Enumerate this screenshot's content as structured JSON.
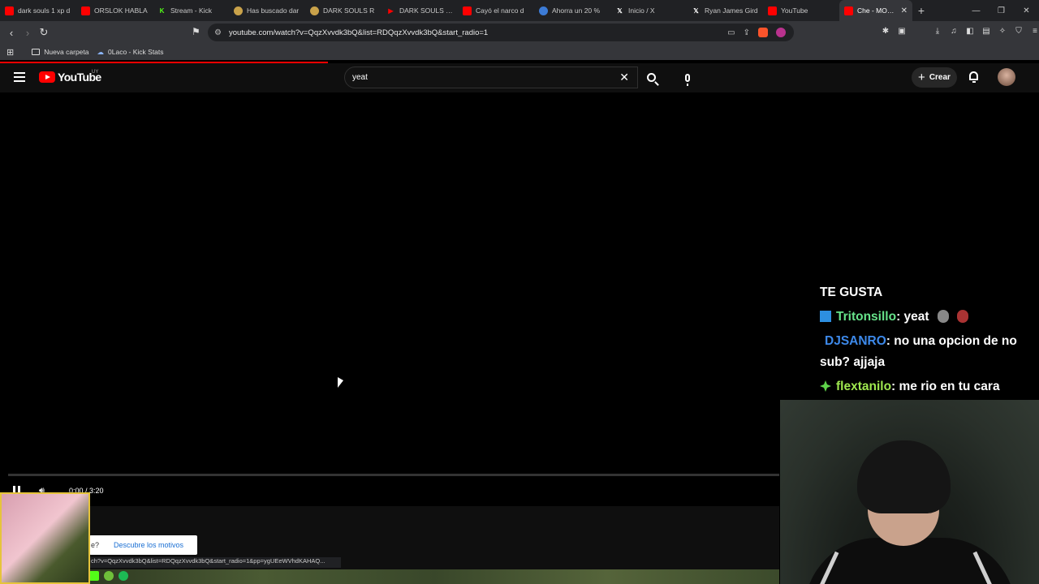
{
  "browser": {
    "tabs": [
      {
        "label": "dark souls 1 xp d",
        "icon": "youtube-icon",
        "color": "#ff0000"
      },
      {
        "label": "ORSLOK HABLA",
        "icon": "youtube-icon",
        "color": "#ff0000"
      },
      {
        "label": "Stream - Kick",
        "icon": "kick-icon",
        "color": "#53fc18"
      },
      {
        "label": "Has buscado dar",
        "icon": "game-icon",
        "color": "#c9a24a"
      },
      {
        "label": "DARK SOULS R",
        "icon": "game-icon",
        "color": "#c9a24a"
      },
      {
        "label": "DARK SOULS RE",
        "icon": "play-icon",
        "color": "#ff0000"
      },
      {
        "label": "Cayó el narco d",
        "icon": "youtube-icon",
        "color": "#ff0000"
      },
      {
        "label": "Ahorra un 20 %",
        "icon": "steam-icon",
        "color": "#3c7bd6"
      },
      {
        "label": "Inicio / X",
        "icon": "x-icon",
        "color": "#ffffff"
      },
      {
        "label": "Ryan James Gird",
        "icon": "x-icon",
        "color": "#ffffff"
      },
      {
        "label": "YouTube",
        "icon": "youtube-icon",
        "color": "#ff0000"
      },
      {
        "label": "Che - MONS",
        "icon": "youtube-icon",
        "color": "#ff0000",
        "active": true
      }
    ],
    "url": "youtube.com/watch?v=QqzXvvdk3bQ&list=RDQqzXvvdk3bQ&start_radio=1",
    "bookmarks": [
      "Nueva carpeta",
      "0Laco - Kick Stats"
    ],
    "status_url": "ch?v=QqzXvvdk3bQ&list=RDQqzXvvdk3bQ&start_radio=1&pp=ygUEeWVhdKAHAQ..."
  },
  "youtube": {
    "logo_text": "YouTube",
    "country_code": "UY",
    "search_value": "yeat",
    "create_label": "Crear",
    "player": {
      "timecode": "0:00 / 3:20",
      "progress_fraction": 0.0
    },
    "notice": {
      "question": "e?",
      "link": "Descubre los motivos"
    }
  },
  "overlay": {
    "chat_title": "TE GUSTA",
    "messages": [
      {
        "user": "Tritonsillo",
        "text": ": yeat",
        "color": "#66e38a",
        "badge": "blue"
      },
      {
        "user": "DJSANRO",
        "text": ": no una opcion de no sub? ajjaja",
        "color": "#3d89ea",
        "badge": "none"
      },
      {
        "user": "flextanilo",
        "text": ": me rio en tu cara",
        "color": "#9fe84f",
        "badge": "green"
      }
    ]
  },
  "colors": {
    "yt_red": "#ff0000",
    "chrome_dark": "#202124",
    "chrome_toolbar": "#35363a"
  }
}
